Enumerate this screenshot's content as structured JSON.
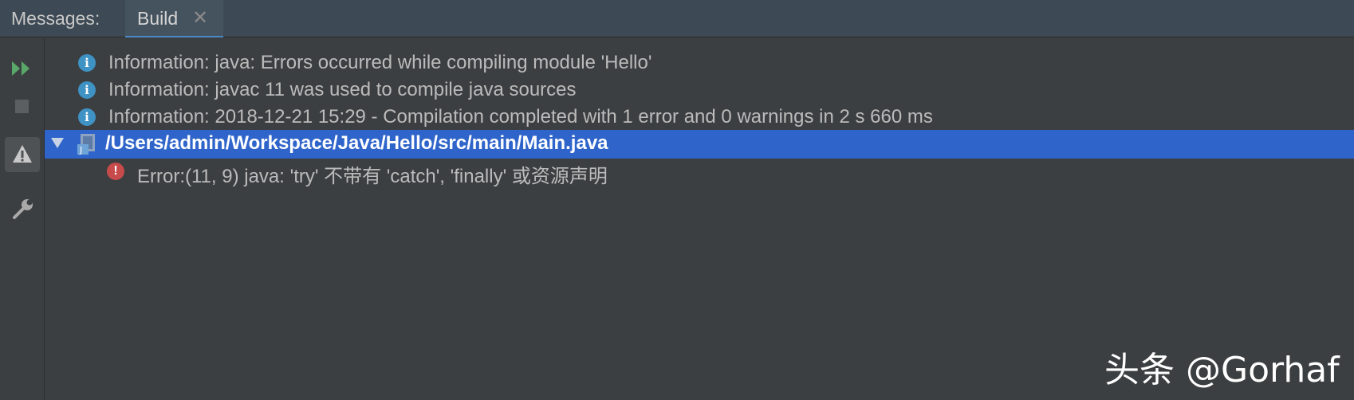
{
  "tabbar": {
    "label": "Messages:",
    "active_tab": "Build",
    "close_glyph": "✕"
  },
  "toolbar": {
    "buttons": [
      "rerun-icon",
      "stop-icon",
      "warning-filter-icon",
      "settings-wrench-icon"
    ]
  },
  "messages": {
    "info": [
      "Information: java: Errors occurred while compiling module 'Hello'",
      "Information: javac 11 was used to compile java sources",
      "Information: 2018-12-21 15:29 - Compilation completed with 1 error and 0 warnings in 2 s 660 ms"
    ],
    "file": {
      "path": "/Users/admin/Workspace/Java/Hello/src/main/Main.java",
      "error": "Error:(11, 9)  java: 'try' 不带有 'catch', 'finally' 或资源声明"
    }
  },
  "watermark": "头条 @Gorhaf",
  "colors": {
    "accent_blue": "#2f65ca",
    "info_icon": "#3e92c4",
    "error_icon": "#c74b4b",
    "run_green": "#59a869"
  }
}
